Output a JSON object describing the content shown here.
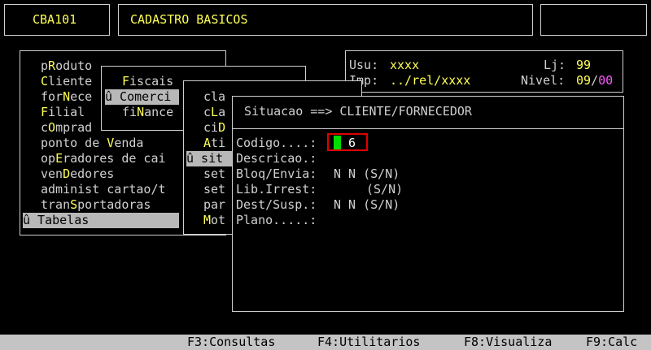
{
  "header": {
    "program_code": "CBA101",
    "screen_title": "CADASTRO BASICOS"
  },
  "info_panel": {
    "user_label": "Usu:",
    "user_value": "xxxx",
    "store_label": "Lj:",
    "store_value": "99",
    "printer_label": "Imp:",
    "printer_value": "../rel/xxxx",
    "level_label": "Nivel:",
    "level_value": "09",
    "level_sep": "/",
    "level_value2": "00"
  },
  "main_menu": {
    "items": [
      {
        "pre": "p",
        "hot": "R",
        "post": "oduto"
      },
      {
        "pre": "",
        "hot": "C",
        "post": "liente"
      },
      {
        "pre": "for",
        "hot": "N",
        "post": "ece"
      },
      {
        "pre": "",
        "hot": "F",
        "post": "ilial"
      },
      {
        "pre": "c",
        "hot": "O",
        "post": "mprad"
      },
      {
        "pre": "ponto de ",
        "hot": "V",
        "post": "enda"
      },
      {
        "pre": "op",
        "hot": "E",
        "post": "radores de cai"
      },
      {
        "pre": "ven",
        "hot": "D",
        "post": "edores"
      },
      {
        "pre": "administ cartao/t",
        "hot": "",
        "post": ""
      },
      {
        "pre": "tran",
        "hot": "S",
        "post": "portadoras"
      }
    ],
    "selected_label": "û Tabelas"
  },
  "sub_menu_1": {
    "items": [
      {
        "text": "Fiscais",
        "hot": "F",
        "selected": false
      },
      {
        "text": "û Comerci",
        "hot": "",
        "selected": true
      },
      {
        "text": "fiNance",
        "hot": "N",
        "selected": false
      }
    ]
  },
  "sub_menu_2": {
    "items": [
      "cla",
      "cLa",
      "ciD",
      "Ati",
      "û sit",
      "set",
      "set",
      "par",
      "Mot"
    ]
  },
  "dialog": {
    "title": "Situacao ==> CLIENTE/FORNECEDOR",
    "fields": {
      "codigo_label": "Codigo....:",
      "codigo_value": "6",
      "descricao_label": "Descricao.:",
      "bloq_label": "Bloq/Envia:",
      "bloq_value": "N N (S/N)",
      "lib_label": "Lib.Irrest:",
      "lib_value": "(S/N)",
      "dest_label": "Dest/Susp.:",
      "dest_value": "N N (S/N)",
      "plano_label": "Plano.....:"
    }
  },
  "status_bar": {
    "f3": "F3:Consultas",
    "f4": "F4:Utilitarios",
    "f8": "F8:Visualiza",
    "f9": "F9:Calc"
  },
  "colors": {
    "background": "#000000",
    "text": "#d0d0d0",
    "highlight": "#ffff55",
    "accent_magenta": "#ff55ff",
    "cursor": "#00dd00",
    "focus_border": "#e00000",
    "status_bar": "#c4c4c4"
  }
}
